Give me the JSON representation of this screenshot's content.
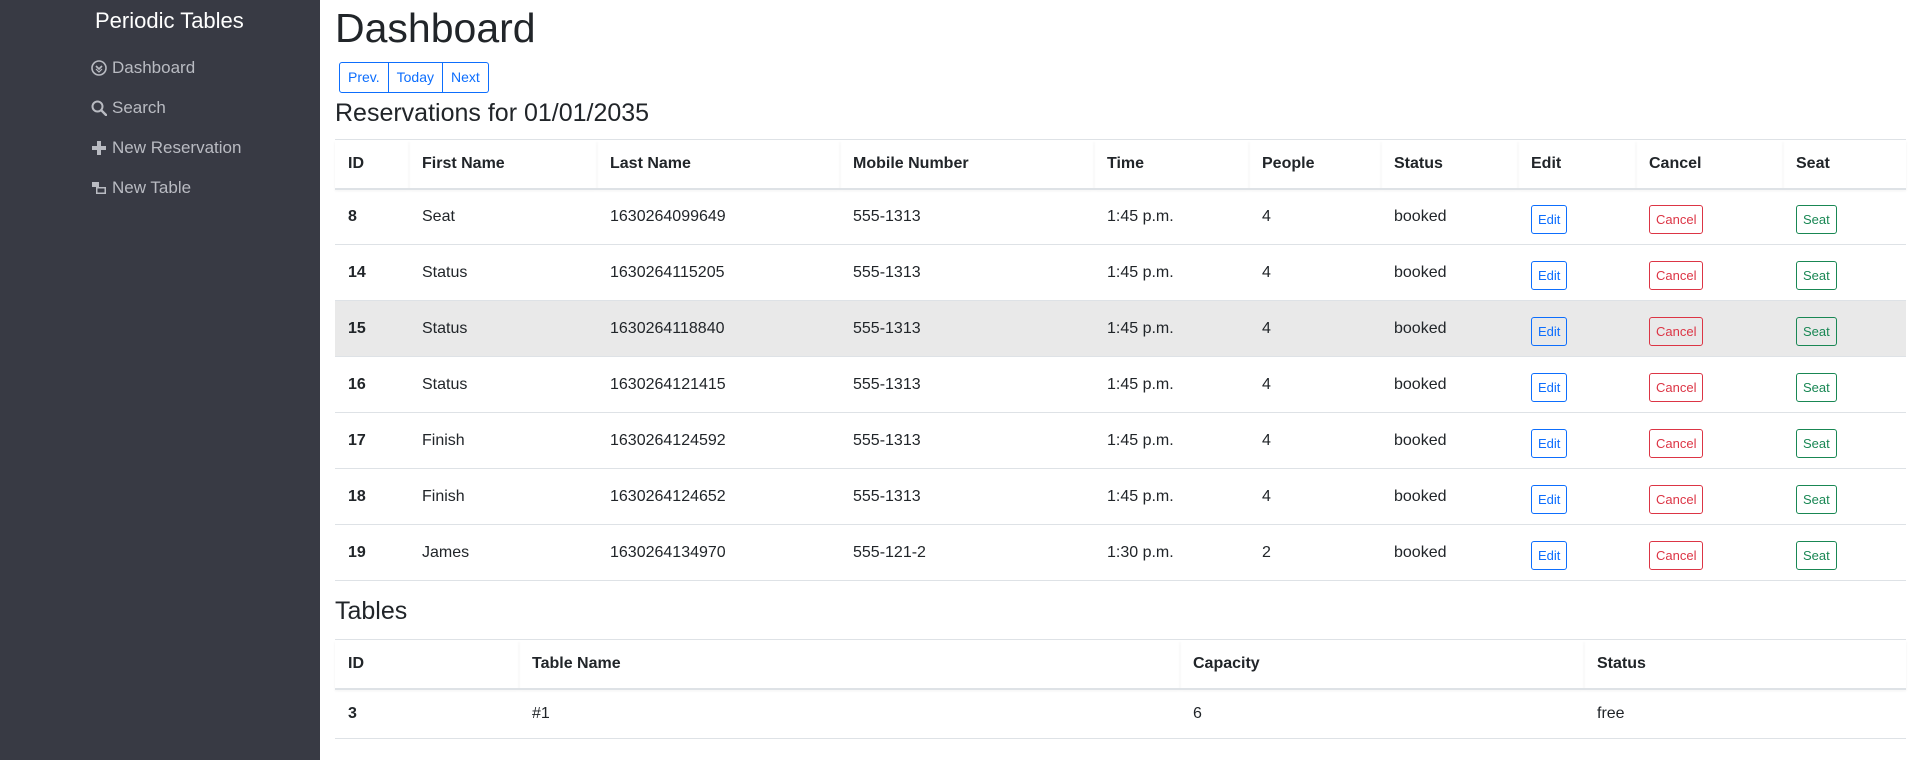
{
  "sidebar": {
    "brand": "Periodic Tables",
    "items": [
      {
        "label": "Dashboard",
        "icon": "dashboard-icon"
      },
      {
        "label": "Search",
        "icon": "search-icon"
      },
      {
        "label": "New Reservation",
        "icon": "plus-icon"
      },
      {
        "label": "New Table",
        "icon": "table-icon"
      }
    ]
  },
  "main": {
    "title": "Dashboard",
    "nav_buttons": {
      "prev": "Prev.",
      "today": "Today",
      "next": "Next"
    },
    "reservations_title": "Reservations for 01/01/2035",
    "reservations_headers": [
      "ID",
      "First Name",
      "Last Name",
      "Mobile Number",
      "Time",
      "People",
      "Status",
      "Edit",
      "Cancel",
      "Seat"
    ],
    "reservations": [
      {
        "id": "8",
        "first": "Seat",
        "last": "1630264099649",
        "mobile": "555-1313",
        "time": "1:45 p.m.",
        "people": "4",
        "status": "booked",
        "edit": "Edit",
        "cancel": "Cancel",
        "seat": "Seat"
      },
      {
        "id": "14",
        "first": "Status",
        "last": "1630264115205",
        "mobile": "555-1313",
        "time": "1:45 p.m.",
        "people": "4",
        "status": "booked",
        "edit": "Edit",
        "cancel": "Cancel",
        "seat": "Seat"
      },
      {
        "id": "15",
        "first": "Status",
        "last": "1630264118840",
        "mobile": "555-1313",
        "time": "1:45 p.m.",
        "people": "4",
        "status": "booked",
        "edit": "Edit",
        "cancel": "Cancel",
        "seat": "Seat"
      },
      {
        "id": "16",
        "first": "Status",
        "last": "1630264121415",
        "mobile": "555-1313",
        "time": "1:45 p.m.",
        "people": "4",
        "status": "booked",
        "edit": "Edit",
        "cancel": "Cancel",
        "seat": "Seat"
      },
      {
        "id": "17",
        "first": "Finish",
        "last": "1630264124592",
        "mobile": "555-1313",
        "time": "1:45 p.m.",
        "people": "4",
        "status": "booked",
        "edit": "Edit",
        "cancel": "Cancel",
        "seat": "Seat"
      },
      {
        "id": "18",
        "first": "Finish",
        "last": "1630264124652",
        "mobile": "555-1313",
        "time": "1:45 p.m.",
        "people": "4",
        "status": "booked",
        "edit": "Edit",
        "cancel": "Cancel",
        "seat": "Seat"
      },
      {
        "id": "19",
        "first": "James",
        "last": "1630264134970",
        "mobile": "555-121-2",
        "time": "1:30 p.m.",
        "people": "2",
        "status": "booked",
        "edit": "Edit",
        "cancel": "Cancel",
        "seat": "Seat"
      }
    ],
    "tables_title": "Tables",
    "tables_headers": [
      "ID",
      "Table Name",
      "Capacity",
      "Status"
    ],
    "tables": [
      {
        "id": "3",
        "name": "#1",
        "capacity": "6",
        "status": "free"
      }
    ]
  },
  "colors": {
    "sidebar_bg": "#383a44",
    "primary": "#0d6efd",
    "danger": "#dc3545",
    "success": "#198754",
    "row_highlight": "#e9e9e9"
  }
}
